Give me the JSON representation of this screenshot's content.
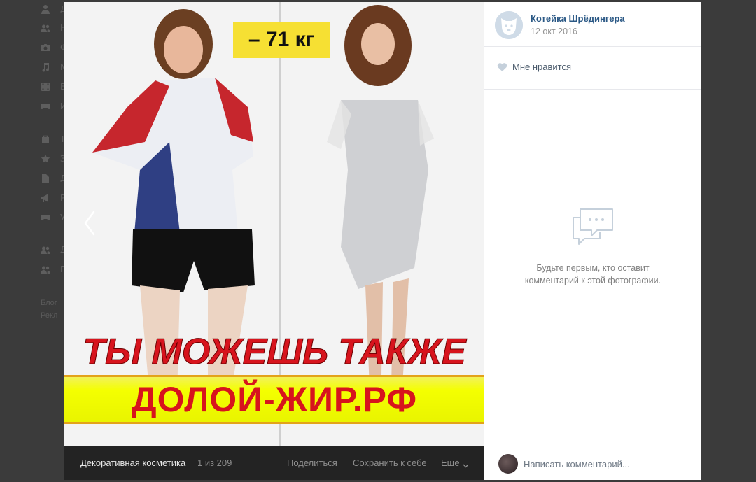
{
  "background_sidebar": {
    "items": [
      {
        "icon": "user-icon",
        "label": "Д"
      },
      {
        "icon": "news-icon",
        "label": "Н"
      },
      {
        "icon": "camera-icon",
        "label": "Ф"
      },
      {
        "icon": "music-icon",
        "label": "М"
      },
      {
        "icon": "video-icon",
        "label": "В"
      },
      {
        "icon": "gamepad-icon",
        "label": "И"
      },
      {
        "icon": "bag-icon",
        "label": "Т"
      },
      {
        "icon": "star-icon",
        "label": "З"
      },
      {
        "icon": "document-icon",
        "label": "Д"
      },
      {
        "icon": "megaphone-icon",
        "label": "Р"
      },
      {
        "icon": "gamepad-icon",
        "label": "У"
      },
      {
        "icon": "group-icon",
        "label": "Д"
      },
      {
        "icon": "group-icon",
        "label": "П"
      }
    ],
    "footer": [
      "Блог",
      "Рекл"
    ]
  },
  "photo": {
    "badge_text": "– 71 кг",
    "slogan": "ТЫ МОЖЕШЬ ТАКЖЕ",
    "banner_text": "ДОЛОЙ-ЖИР.РФ",
    "prev_icon": "chevron-left-icon"
  },
  "photo_bar": {
    "album_title": "Декоративная косметика",
    "photo_count": "1 из 209",
    "share_label": "Поделиться",
    "save_label": "Сохранить к себе",
    "more_label": "Ещё"
  },
  "author": {
    "name": "Котейка Шрёдингера",
    "date": "12 окт 2016",
    "avatar_icon": "dog-avatar-icon"
  },
  "like": {
    "icon": "heart-icon",
    "label": "Мне нравится"
  },
  "comments": {
    "icon": "speech-bubbles-icon",
    "empty_line1": "Будьте первым, кто оставит",
    "empty_line2": "комментарий к этой фотографии."
  },
  "composer": {
    "placeholder": "Написать комментарий..."
  },
  "colors": {
    "link": "#2a5885",
    "accent_red": "#d7141d",
    "banner_yellow": "#f4ff00",
    "badge_yellow": "#f6e033"
  }
}
